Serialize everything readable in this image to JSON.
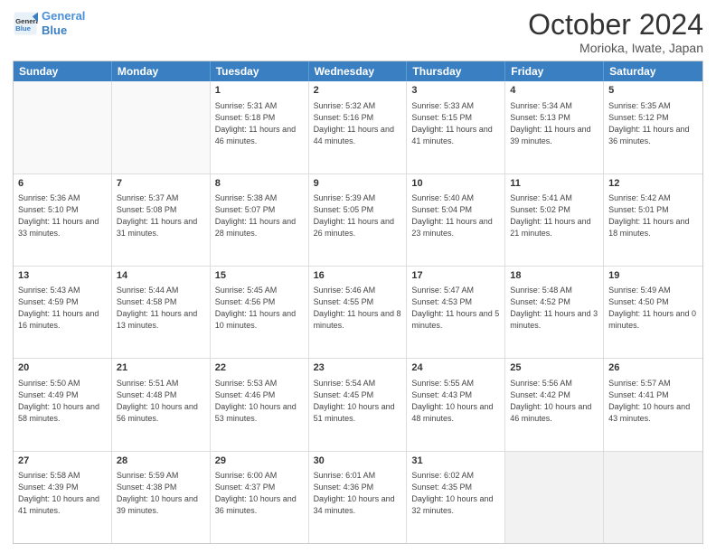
{
  "header": {
    "logo_line1": "General",
    "logo_line2": "Blue",
    "month_title": "October 2024",
    "location": "Morioka, Iwate, Japan"
  },
  "days_of_week": [
    "Sunday",
    "Monday",
    "Tuesday",
    "Wednesday",
    "Thursday",
    "Friday",
    "Saturday"
  ],
  "weeks": [
    [
      {
        "day": "",
        "detail": ""
      },
      {
        "day": "",
        "detail": ""
      },
      {
        "day": "1",
        "detail": "Sunrise: 5:31 AM\nSunset: 5:18 PM\nDaylight: 11 hours and 46 minutes."
      },
      {
        "day": "2",
        "detail": "Sunrise: 5:32 AM\nSunset: 5:16 PM\nDaylight: 11 hours and 44 minutes."
      },
      {
        "day": "3",
        "detail": "Sunrise: 5:33 AM\nSunset: 5:15 PM\nDaylight: 11 hours and 41 minutes."
      },
      {
        "day": "4",
        "detail": "Sunrise: 5:34 AM\nSunset: 5:13 PM\nDaylight: 11 hours and 39 minutes."
      },
      {
        "day": "5",
        "detail": "Sunrise: 5:35 AM\nSunset: 5:12 PM\nDaylight: 11 hours and 36 minutes."
      }
    ],
    [
      {
        "day": "6",
        "detail": "Sunrise: 5:36 AM\nSunset: 5:10 PM\nDaylight: 11 hours and 33 minutes."
      },
      {
        "day": "7",
        "detail": "Sunrise: 5:37 AM\nSunset: 5:08 PM\nDaylight: 11 hours and 31 minutes."
      },
      {
        "day": "8",
        "detail": "Sunrise: 5:38 AM\nSunset: 5:07 PM\nDaylight: 11 hours and 28 minutes."
      },
      {
        "day": "9",
        "detail": "Sunrise: 5:39 AM\nSunset: 5:05 PM\nDaylight: 11 hours and 26 minutes."
      },
      {
        "day": "10",
        "detail": "Sunrise: 5:40 AM\nSunset: 5:04 PM\nDaylight: 11 hours and 23 minutes."
      },
      {
        "day": "11",
        "detail": "Sunrise: 5:41 AM\nSunset: 5:02 PM\nDaylight: 11 hours and 21 minutes."
      },
      {
        "day": "12",
        "detail": "Sunrise: 5:42 AM\nSunset: 5:01 PM\nDaylight: 11 hours and 18 minutes."
      }
    ],
    [
      {
        "day": "13",
        "detail": "Sunrise: 5:43 AM\nSunset: 4:59 PM\nDaylight: 11 hours and 16 minutes."
      },
      {
        "day": "14",
        "detail": "Sunrise: 5:44 AM\nSunset: 4:58 PM\nDaylight: 11 hours and 13 minutes."
      },
      {
        "day": "15",
        "detail": "Sunrise: 5:45 AM\nSunset: 4:56 PM\nDaylight: 11 hours and 10 minutes."
      },
      {
        "day": "16",
        "detail": "Sunrise: 5:46 AM\nSunset: 4:55 PM\nDaylight: 11 hours and 8 minutes."
      },
      {
        "day": "17",
        "detail": "Sunrise: 5:47 AM\nSunset: 4:53 PM\nDaylight: 11 hours and 5 minutes."
      },
      {
        "day": "18",
        "detail": "Sunrise: 5:48 AM\nSunset: 4:52 PM\nDaylight: 11 hours and 3 minutes."
      },
      {
        "day": "19",
        "detail": "Sunrise: 5:49 AM\nSunset: 4:50 PM\nDaylight: 11 hours and 0 minutes."
      }
    ],
    [
      {
        "day": "20",
        "detail": "Sunrise: 5:50 AM\nSunset: 4:49 PM\nDaylight: 10 hours and 58 minutes."
      },
      {
        "day": "21",
        "detail": "Sunrise: 5:51 AM\nSunset: 4:48 PM\nDaylight: 10 hours and 56 minutes."
      },
      {
        "day": "22",
        "detail": "Sunrise: 5:53 AM\nSunset: 4:46 PM\nDaylight: 10 hours and 53 minutes."
      },
      {
        "day": "23",
        "detail": "Sunrise: 5:54 AM\nSunset: 4:45 PM\nDaylight: 10 hours and 51 minutes."
      },
      {
        "day": "24",
        "detail": "Sunrise: 5:55 AM\nSunset: 4:43 PM\nDaylight: 10 hours and 48 minutes."
      },
      {
        "day": "25",
        "detail": "Sunrise: 5:56 AM\nSunset: 4:42 PM\nDaylight: 10 hours and 46 minutes."
      },
      {
        "day": "26",
        "detail": "Sunrise: 5:57 AM\nSunset: 4:41 PM\nDaylight: 10 hours and 43 minutes."
      }
    ],
    [
      {
        "day": "27",
        "detail": "Sunrise: 5:58 AM\nSunset: 4:39 PM\nDaylight: 10 hours and 41 minutes."
      },
      {
        "day": "28",
        "detail": "Sunrise: 5:59 AM\nSunset: 4:38 PM\nDaylight: 10 hours and 39 minutes."
      },
      {
        "day": "29",
        "detail": "Sunrise: 6:00 AM\nSunset: 4:37 PM\nDaylight: 10 hours and 36 minutes."
      },
      {
        "day": "30",
        "detail": "Sunrise: 6:01 AM\nSunset: 4:36 PM\nDaylight: 10 hours and 34 minutes."
      },
      {
        "day": "31",
        "detail": "Sunrise: 6:02 AM\nSunset: 4:35 PM\nDaylight: 10 hours and 32 minutes."
      },
      {
        "day": "",
        "detail": ""
      },
      {
        "day": "",
        "detail": ""
      }
    ]
  ]
}
